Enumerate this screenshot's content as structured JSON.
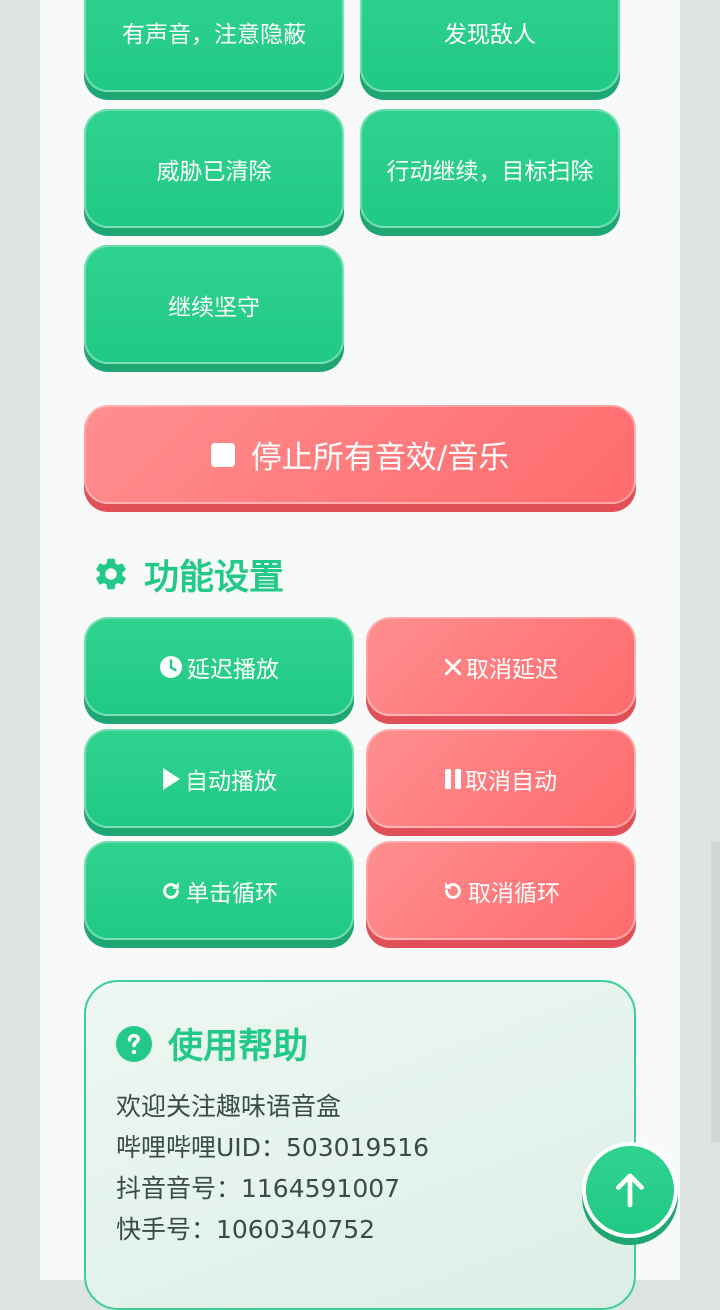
{
  "sound_buttons": [
    {
      "label": "有声音，注意隐蔽"
    },
    {
      "label": "发现敌人"
    },
    {
      "label": "威胁已清除"
    },
    {
      "label": "行动继续，目标扫除"
    },
    {
      "label": "继续坚守"
    }
  ],
  "stop_all": {
    "label": "停止所有音效/音乐",
    "icon": "stop-icon"
  },
  "settings": {
    "title": "功能设置",
    "title_icon": "gear-icon",
    "buttons": [
      {
        "label": "延迟播放",
        "icon": "clock-icon",
        "color": "#22c988"
      },
      {
        "label": "取消延迟",
        "icon": "close-icon",
        "color": "#ff6b6e"
      },
      {
        "label": "自动播放",
        "icon": "play-icon",
        "color": "#22c988"
      },
      {
        "label": "取消自动",
        "icon": "pause-icon",
        "color": "#ff6b6e"
      },
      {
        "label": "单击循环",
        "icon": "redo-icon",
        "color": "#22c988"
      },
      {
        "label": "取消循环",
        "icon": "undo-icon",
        "color": "#ff6b6e"
      }
    ]
  },
  "help": {
    "title": "使用帮助",
    "title_icon": "help-icon",
    "lines": [
      "欢迎关注趣味语音盒",
      "哔哩哔哩UID：503019516",
      "抖音音号：1164591007",
      "快手号：1060340752"
    ]
  },
  "back_to_top": {
    "icon": "arrow-up-icon"
  },
  "colors": {
    "accent_green": "#22c988",
    "accent_red": "#ff6b6e"
  }
}
